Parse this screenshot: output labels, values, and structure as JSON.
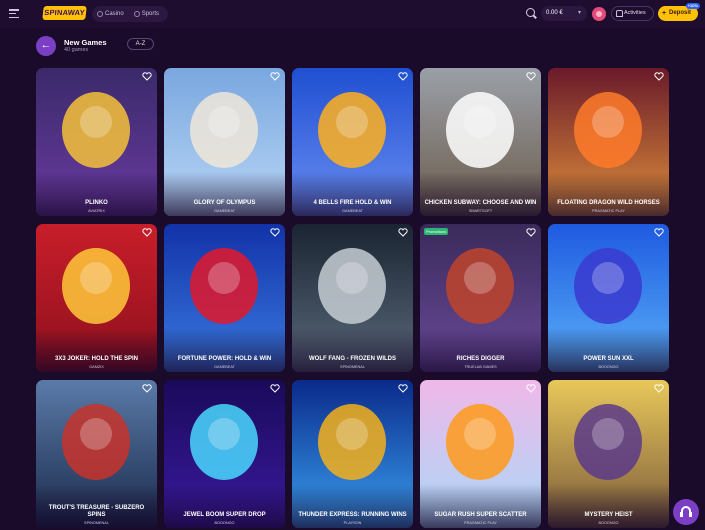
{
  "header": {
    "logo_text": "SPINAWAY",
    "tabs": [
      {
        "label": "Casino"
      },
      {
        "label": "Sports"
      }
    ],
    "balance": "0.00 €",
    "activities_label": "Activities",
    "deposit_label": "Deposit",
    "deposit_badge": "+10%"
  },
  "page": {
    "title": "New Games",
    "subtitle": "40 games",
    "sort_label": "A-Z"
  },
  "games": [
    {
      "title": "PLINKO",
      "provider": "AVIATRIX",
      "bg": [
        "#3a2a6a",
        "#6a3aa0"
      ],
      "accent": "#f6c23a"
    },
    {
      "title": "GLORY OF OLYMPUS",
      "provider": "GAMEBEAT",
      "bg": [
        "#7aa7e0",
        "#b8d6f4"
      ],
      "accent": "#f0e6d8"
    },
    {
      "title": "4 BELLS FIRE HOLD & WIN",
      "provider": "GAMEBEAT",
      "bg": [
        "#1f4fd1",
        "#6a8ef2"
      ],
      "accent": "#ffb01f"
    },
    {
      "title": "CHICKEN SUBWAY: CHOOSE AND WIN",
      "provider": "SMARTSOFT",
      "bg": [
        "#9aa0a8",
        "#6b5a4a"
      ],
      "accent": "#ffffff"
    },
    {
      "title": "FLOATING DRAGON WILD HORSES",
      "provider": "PRAGMATIC PLAY",
      "bg": [
        "#6a1a2a",
        "#e0903a"
      ],
      "accent": "#ff7a2a"
    },
    {
      "title": "3X3 JOKER: HOLD THE SPIN",
      "provider": "GAMZIX",
      "bg": [
        "#c81e2a",
        "#8e0f1d"
      ],
      "accent": "#ffc93a"
    },
    {
      "title": "FORTUNE POWER: HOLD & WIN",
      "provider": "GAMEBEAT",
      "bg": [
        "#1232a8",
        "#3a7ae0"
      ],
      "accent": "#e3182a"
    },
    {
      "title": "WOLF FANG - FROZEN WILDS",
      "provider": "SPINOMENAL",
      "bg": [
        "#1a2432",
        "#5a6a7a"
      ],
      "accent": "#c6ccd4"
    },
    {
      "title": "RICHES DIGGER",
      "provider": "TRUELAB GAMES",
      "bg": [
        "#3a2a5a",
        "#6a4a9a"
      ],
      "accent": "#c0442a",
      "tag": "Promotions"
    },
    {
      "title": "POWER SUN XXL",
      "provider": "BOOONGO",
      "bg": [
        "#1e5ae0",
        "#5ab0f8"
      ],
      "accent": "#3a3ad0"
    },
    {
      "title": "TROUT'S TREASURE - SUBZERO SPINS",
      "provider": "SPINOMENAL",
      "bg": [
        "#5a7aa8",
        "#1a2a4a"
      ],
      "accent": "#c8322a"
    },
    {
      "title": "JEWEL BOOM SUPER DROP",
      "provider": "BOOONGO",
      "bg": [
        "#1a0a5a",
        "#3a1aa0"
      ],
      "accent": "#4ad8ff"
    },
    {
      "title": "THUNDER EXPRESS: RUNNING WINS",
      "provider": "PLAYSON",
      "bg": [
        "#0a2a8a",
        "#3aa0f0"
      ],
      "accent": "#f4b01a"
    },
    {
      "title": "SUGAR RUSH SUPER SCATTER",
      "provider": "PRAGMATIC PLAY",
      "bg": [
        "#f0b8e8",
        "#a8d8f8"
      ],
      "accent": "#ff9a1a"
    },
    {
      "title": "MYSTERY HEIST",
      "provider": "BOOONGO",
      "bg": [
        "#e8c85a",
        "#7a5a3a"
      ],
      "accent": "#5a3a8a"
    }
  ]
}
